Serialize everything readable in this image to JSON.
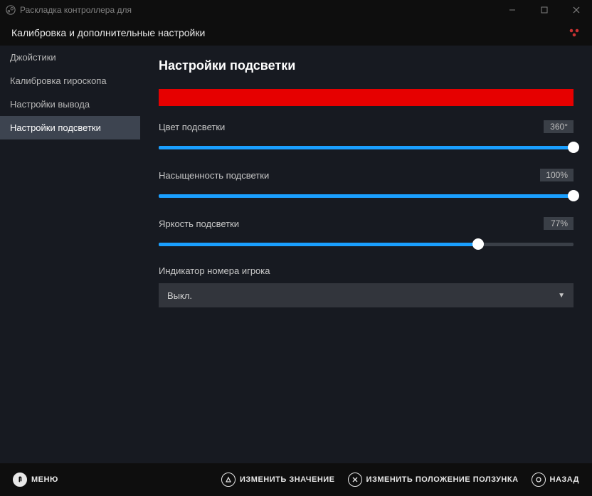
{
  "window": {
    "title": "Раскладка контроллера для"
  },
  "header": {
    "title": "Калибровка и дополнительные настройки"
  },
  "sidebar": {
    "items": [
      {
        "label": "Джойстики"
      },
      {
        "label": "Калибровка гироскопа"
      },
      {
        "label": "Настройки вывода"
      },
      {
        "label": "Настройки подсветки"
      }
    ]
  },
  "main": {
    "title": "Настройки подсветки",
    "preview_color": "#e60000",
    "settings": [
      {
        "label": "Цвет подсветки",
        "value": "360°",
        "percent": 100
      },
      {
        "label": "Насыщенность подсветки",
        "value": "100%",
        "percent": 100
      },
      {
        "label": "Яркость подсветки",
        "value": "77%",
        "percent": 77
      }
    ],
    "player_indicator": {
      "label": "Индикатор номера игрока",
      "value": "Выкл."
    }
  },
  "footer": {
    "menu": "МЕНЮ",
    "change_value": "ИЗМЕНИТЬ ЗНАЧЕНИЕ",
    "change_slider": "ИЗМЕНИТЬ ПОЛОЖЕНИЕ ПОЛЗУНКА",
    "back": "НАЗАД"
  }
}
